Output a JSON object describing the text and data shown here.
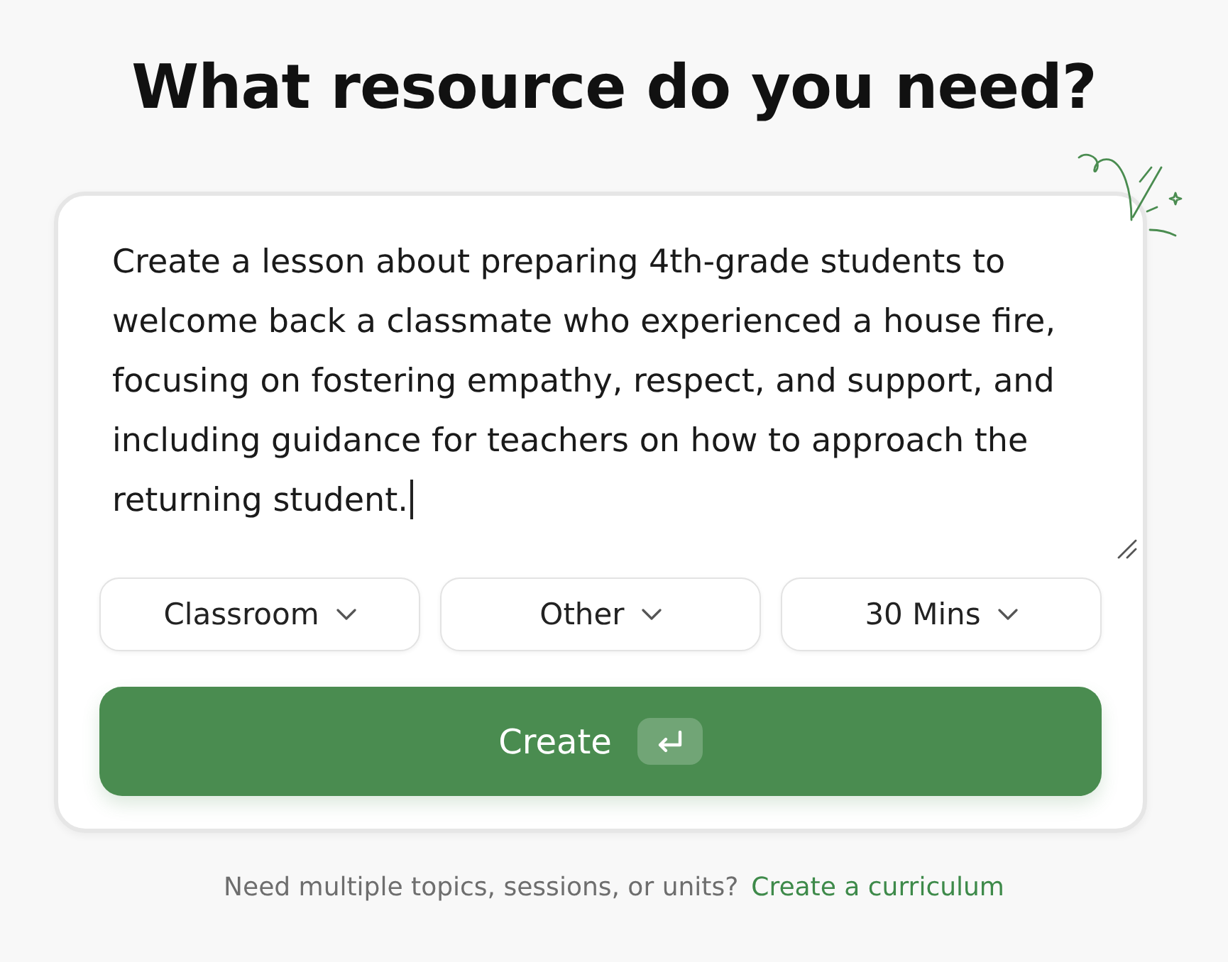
{
  "title": "What resource do you need?",
  "prompt": {
    "value": "Create a lesson about preparing 4th-grade students to welcome back a classmate who experienced a house fire, focusing on fostering empathy, respect, and support, and including guidance for teachers on how to approach the returning student.",
    "focused": true
  },
  "options": [
    {
      "label": "Classroom"
    },
    {
      "label": "Other"
    },
    {
      "label": "30 Mins"
    }
  ],
  "create_button": {
    "label": "Create"
  },
  "footer": {
    "text": "Need multiple topics, sessions, or units?",
    "link": "Create a curriculum"
  }
}
